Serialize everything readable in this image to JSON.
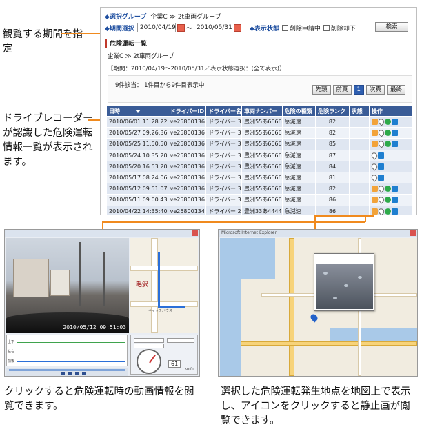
{
  "callouts": {
    "period": "観覧する期間を指定",
    "list": "ドライブレコーダーが認識した危険運転情報一覧が表示されます。",
    "video": "クリックすると危険運転時の動画情報を閲覧できます。",
    "map": "選択した危険運転発生地点を地図上で表示し、アイコンをクリックすると静止画が閲覧できます。"
  },
  "filters": {
    "group_label": "◆選択グループ",
    "group_value": "企業C ≫ 2t車両グループ",
    "period_label": "◆期間選択",
    "date_from": "2010/04/19",
    "tilde": "～",
    "date_to": "2010/05/31",
    "status_label": "◆表示状態",
    "status_opt1": "削除申請中",
    "status_opt2": "削除却下",
    "search_button": "検索"
  },
  "list": {
    "section_title": "危険運転一覧",
    "breadcrumb": "企業C ≫ 2t車両グループ",
    "condition": "【期間：2010/04/19～2010/05/31／表示状態選択：(全て表示)】",
    "count_text": "9件該当： 1件目から9件目表示中",
    "pager": {
      "first": "先頭",
      "prev": "前頁",
      "current": "1",
      "next": "次頁",
      "last": "最終"
    },
    "columns": [
      "日時",
      "ドライバーID",
      "ドライバー名",
      "車両ナンバー",
      "危険の種類",
      "危険ランク",
      "状態",
      "操作"
    ],
    "rows": [
      {
        "date": "2010/06/01 11:28:22",
        "driver_id": "ve25800136",
        "driver": "ドライバー 3",
        "plate": "豊洲55あ6666",
        "type": "急減速",
        "rank": "82",
        "status": ""
      },
      {
        "date": "2010/05/27 09:26:36",
        "driver_id": "ve25800136",
        "driver": "ドライバー 3",
        "plate": "豊洲55あ6666",
        "type": "急減速",
        "rank": "82",
        "status": ""
      },
      {
        "date": "2010/05/25 11:50:50",
        "driver_id": "ve25800136",
        "driver": "ドライバー 3",
        "plate": "豊洲55あ6666",
        "type": "急減速",
        "rank": "85",
        "status": ""
      },
      {
        "date": "2010/05/24 10:35:20",
        "driver_id": "ve25800136",
        "driver": "ドライバー 3",
        "plate": "豊洲55あ6666",
        "type": "急減速",
        "rank": "87",
        "status": ""
      },
      {
        "date": "2010/05/20 16:53:20",
        "driver_id": "ve25800136",
        "driver": "ドライバー 3",
        "plate": "豊洲55あ6666",
        "type": "急減速",
        "rank": "84",
        "status": ""
      },
      {
        "date": "2010/05/17 08:24:06",
        "driver_id": "ve25800136",
        "driver": "ドライバー 3",
        "plate": "豊洲55あ6666",
        "type": "急減速",
        "rank": "81",
        "status": ""
      },
      {
        "date": "2010/05/12 09:51:07",
        "driver_id": "ve25800136",
        "driver": "ドライバー 3",
        "plate": "豊洲55あ6666",
        "type": "急減速",
        "rank": "82",
        "status": ""
      },
      {
        "date": "2010/05/11 09:00:43",
        "driver_id": "ve25800136",
        "driver": "ドライバー 3",
        "plate": "豊洲55あ6666",
        "type": "急減速",
        "rank": "86",
        "status": ""
      },
      {
        "date": "2010/04/22 14:35:40",
        "driver_id": "ve25800134",
        "driver": "ドライバー 2",
        "plate": "豊洲33あ4444",
        "type": "急減速",
        "rank": "86",
        "status": ""
      }
    ]
  },
  "video": {
    "timestamp": "2010/05/12 09:51:03",
    "map_label": "毛沢",
    "map_sublabel": "キャッチハウス",
    "graph_labels": [
      "上下",
      "左右",
      "前後"
    ],
    "speed": "61",
    "speed_unit": "km/h"
  },
  "map": {
    "window_title": "Microsoft Internet Explorer"
  },
  "colors": {
    "accent": "#f08a1e",
    "header_blue": "#3a5c97",
    "label_blue": "#1f4fa0"
  }
}
